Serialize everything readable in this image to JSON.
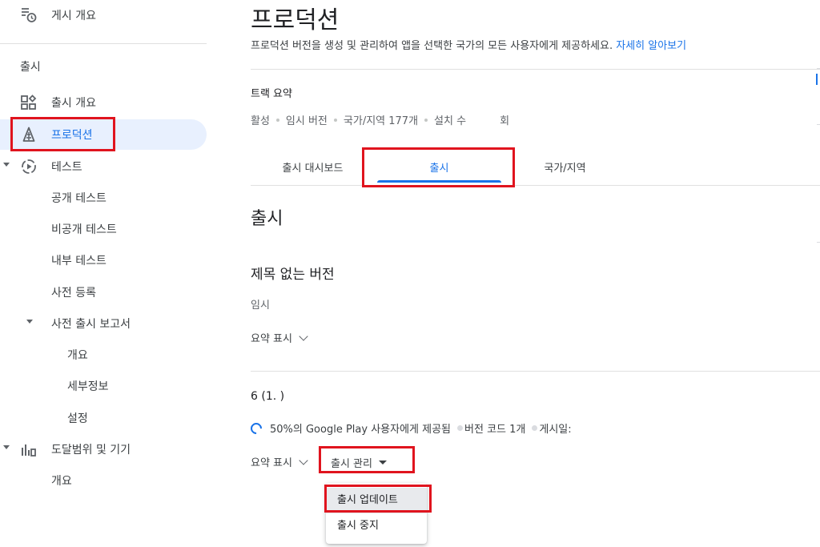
{
  "sidebar": {
    "top_item": "게시 개요",
    "section": "출시",
    "items": [
      {
        "label": "출시 개요"
      },
      {
        "label": "프로덕션"
      },
      {
        "label": "테스트"
      },
      {
        "label": "공개 테스트"
      },
      {
        "label": "비공개 테스트"
      },
      {
        "label": "내부 테스트"
      },
      {
        "label": "사전 등록"
      },
      {
        "label": "사전 출시 보고서"
      },
      {
        "label": "개요"
      },
      {
        "label": "세부정보"
      },
      {
        "label": "설정"
      },
      {
        "label": "도달범위 및 기기"
      },
      {
        "label": "개요"
      }
    ]
  },
  "header": {
    "title": "프로덕션",
    "description": "프로덕션 버전을 생성 및 관리하여 앱을 선택한 국가의 모든 사용자에게 제공하세요.",
    "learn_more": "자세히 알아보기"
  },
  "track_summary": {
    "label": "트랙 요약",
    "status": "활성",
    "release_type": "임시 버전",
    "countries": "국가/지역 177개",
    "installs_label": "설치 수",
    "installs_suffix": "회"
  },
  "tabs": [
    {
      "label": "출시 대시보드"
    },
    {
      "label": "출시"
    },
    {
      "label": "국가/지역"
    }
  ],
  "releases": {
    "heading": "출시",
    "draft": {
      "title": "제목 없는 버전",
      "status": "임시",
      "show_summary": "요약 표시"
    },
    "active": {
      "number": "6 (1.      )",
      "rollout": "50%의 Google Play 사용자에게 제공됨",
      "version_code": "버전 코드 1개",
      "published": "게시일:",
      "show_summary": "요약 표시",
      "manage": "출시 관리"
    }
  },
  "menu": {
    "items": [
      {
        "label": "출시 업데이트"
      },
      {
        "label": "출시 중지"
      }
    ]
  },
  "colors": {
    "accent": "#1a73e8",
    "highlight": "#e0141e",
    "active_bg": "#e8f0fe"
  }
}
